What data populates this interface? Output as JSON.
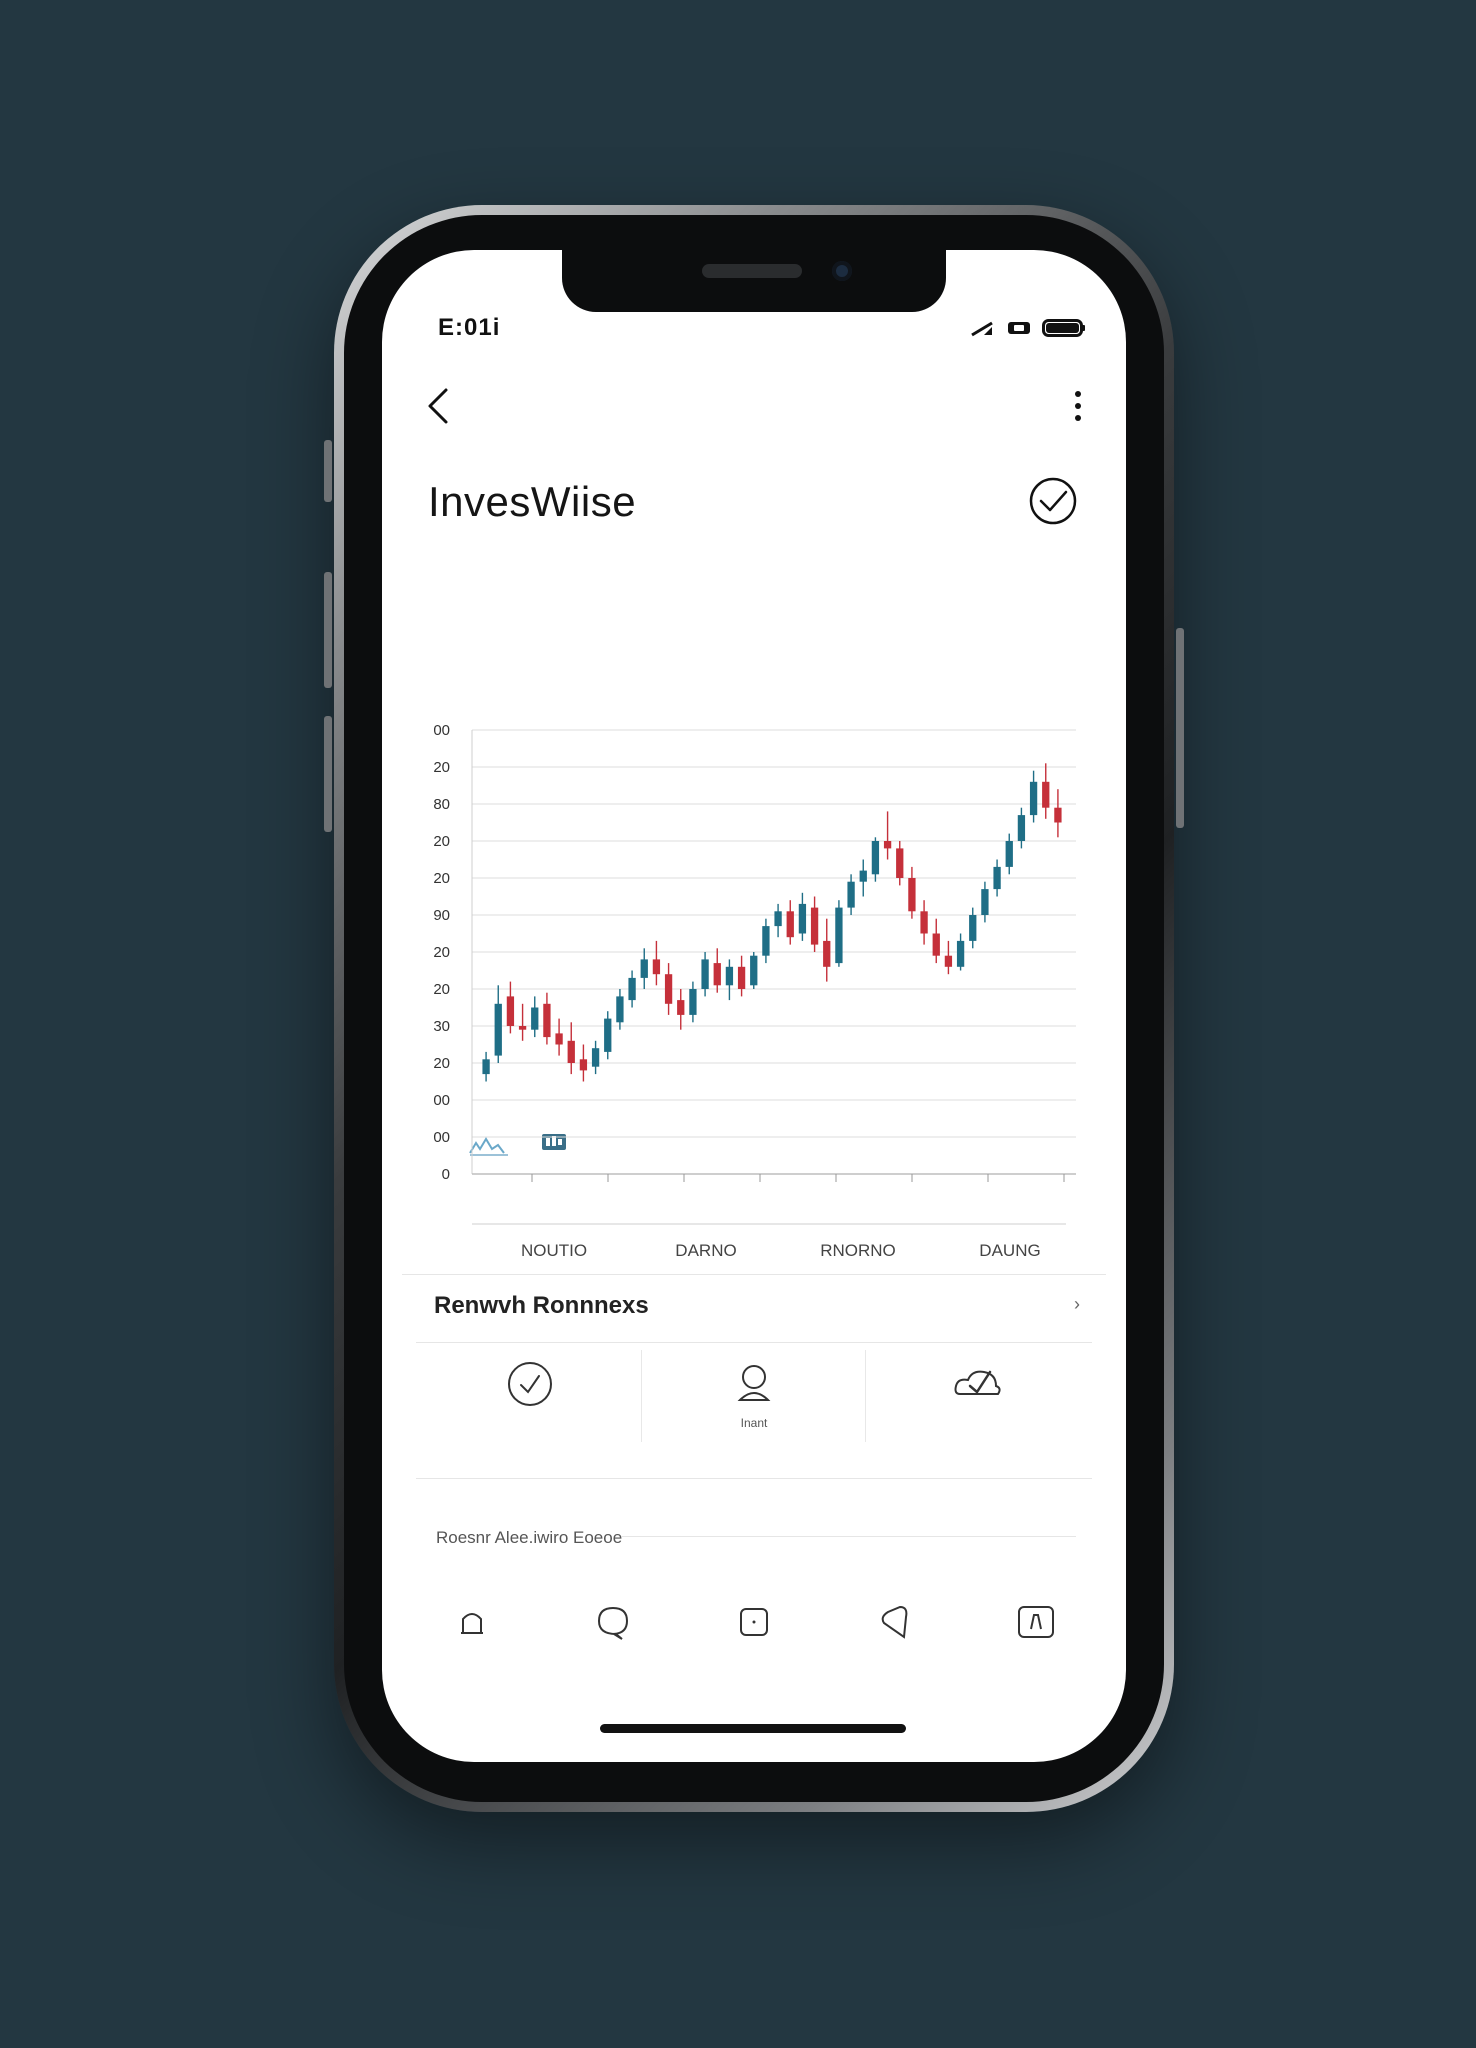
{
  "status_bar": {
    "time": "E:01i"
  },
  "header": {
    "app_title": "InvesWiise"
  },
  "chart_data": {
    "type": "candlestick",
    "y_tick_labels": [
      "0",
      "00",
      "00",
      "20",
      "30",
      "20",
      "20",
      "90",
      "20",
      "20",
      "80",
      "20",
      "00"
    ],
    "x_tick_labels": [
      "NOUTIO",
      "DARNO",
      "RNORNO",
      "DAUNG"
    ],
    "grid": true,
    "colors": {
      "up": "#1f6e86",
      "down": "#c5303a"
    },
    "candles": [
      {
        "o": 2.7,
        "h": 3.3,
        "l": 2.5,
        "c": 3.1
      },
      {
        "o": 3.2,
        "h": 5.1,
        "l": 3.0,
        "c": 4.6
      },
      {
        "o": 4.8,
        "h": 5.2,
        "l": 3.8,
        "c": 4.0
      },
      {
        "o": 4.0,
        "h": 4.6,
        "l": 3.6,
        "c": 3.9
      },
      {
        "o": 3.9,
        "h": 4.8,
        "l": 3.7,
        "c": 4.5
      },
      {
        "o": 4.6,
        "h": 4.9,
        "l": 3.5,
        "c": 3.7
      },
      {
        "o": 3.8,
        "h": 4.2,
        "l": 3.2,
        "c": 3.5
      },
      {
        "o": 3.6,
        "h": 4.1,
        "l": 2.7,
        "c": 3.0
      },
      {
        "o": 3.1,
        "h": 3.5,
        "l": 2.5,
        "c": 2.8
      },
      {
        "o": 2.9,
        "h": 3.6,
        "l": 2.7,
        "c": 3.4
      },
      {
        "o": 3.3,
        "h": 4.4,
        "l": 3.1,
        "c": 4.2
      },
      {
        "o": 4.1,
        "h": 5.0,
        "l": 3.9,
        "c": 4.8
      },
      {
        "o": 4.7,
        "h": 5.5,
        "l": 4.5,
        "c": 5.3
      },
      {
        "o": 5.3,
        "h": 6.1,
        "l": 5.0,
        "c": 5.8
      },
      {
        "o": 5.8,
        "h": 6.3,
        "l": 5.1,
        "c": 5.4
      },
      {
        "o": 5.4,
        "h": 5.7,
        "l": 4.3,
        "c": 4.6
      },
      {
        "o": 4.7,
        "h": 5.0,
        "l": 3.9,
        "c": 4.3
      },
      {
        "o": 4.3,
        "h": 5.2,
        "l": 4.1,
        "c": 5.0
      },
      {
        "o": 5.0,
        "h": 6.0,
        "l": 4.8,
        "c": 5.8
      },
      {
        "o": 5.7,
        "h": 6.1,
        "l": 4.9,
        "c": 5.1
      },
      {
        "o": 5.1,
        "h": 5.8,
        "l": 4.7,
        "c": 5.6
      },
      {
        "o": 5.6,
        "h": 5.9,
        "l": 4.8,
        "c": 5.0
      },
      {
        "o": 5.1,
        "h": 6.0,
        "l": 5.0,
        "c": 5.9
      },
      {
        "o": 5.9,
        "h": 6.9,
        "l": 5.7,
        "c": 6.7
      },
      {
        "o": 6.7,
        "h": 7.3,
        "l": 6.4,
        "c": 7.1
      },
      {
        "o": 7.1,
        "h": 7.4,
        "l": 6.2,
        "c": 6.4
      },
      {
        "o": 6.5,
        "h": 7.6,
        "l": 6.3,
        "c": 7.3
      },
      {
        "o": 7.2,
        "h": 7.5,
        "l": 6.0,
        "c": 6.2
      },
      {
        "o": 6.3,
        "h": 6.9,
        "l": 5.2,
        "c": 5.6
      },
      {
        "o": 5.7,
        "h": 7.4,
        "l": 5.6,
        "c": 7.2
      },
      {
        "o": 7.2,
        "h": 8.1,
        "l": 7.0,
        "c": 7.9
      },
      {
        "o": 7.9,
        "h": 8.5,
        "l": 7.5,
        "c": 8.2
      },
      {
        "o": 8.1,
        "h": 9.1,
        "l": 7.9,
        "c": 9.0
      },
      {
        "o": 9.0,
        "h": 9.8,
        "l": 8.5,
        "c": 8.8
      },
      {
        "o": 8.8,
        "h": 9.0,
        "l": 7.8,
        "c": 8.0
      },
      {
        "o": 8.0,
        "h": 8.3,
        "l": 6.9,
        "c": 7.1
      },
      {
        "o": 7.1,
        "h": 7.4,
        "l": 6.2,
        "c": 6.5
      },
      {
        "o": 6.5,
        "h": 6.9,
        "l": 5.7,
        "c": 5.9
      },
      {
        "o": 5.9,
        "h": 6.3,
        "l": 5.4,
        "c": 5.6
      },
      {
        "o": 5.6,
        "h": 6.5,
        "l": 5.5,
        "c": 6.3
      },
      {
        "o": 6.3,
        "h": 7.2,
        "l": 6.1,
        "c": 7.0
      },
      {
        "o": 7.0,
        "h": 7.9,
        "l": 6.8,
        "c": 7.7
      },
      {
        "o": 7.7,
        "h": 8.5,
        "l": 7.5,
        "c": 8.3
      },
      {
        "o": 8.3,
        "h": 9.2,
        "l": 8.1,
        "c": 9.0
      },
      {
        "o": 9.0,
        "h": 9.9,
        "l": 8.8,
        "c": 9.7
      },
      {
        "o": 9.7,
        "h": 10.9,
        "l": 9.5,
        "c": 10.6
      },
      {
        "o": 10.6,
        "h": 11.1,
        "l": 9.6,
        "c": 9.9
      },
      {
        "o": 9.9,
        "h": 10.4,
        "l": 9.1,
        "c": 9.5
      }
    ]
  },
  "section": {
    "title": "Renwvh Ronnnexs",
    "chevron": "›"
  },
  "quick_actions": [
    {
      "icon": "check-circle-icon",
      "label": ""
    },
    {
      "icon": "user-icon",
      "label": "Inant"
    },
    {
      "icon": "check-cloud-icon",
      "label": ""
    }
  ],
  "subsection": {
    "title": "Roesnr  Alee.iwiro   Eoeoe"
  },
  "bottom_tabs": [
    {
      "icon": "home-icon"
    },
    {
      "icon": "chat-icon"
    },
    {
      "icon": "square-icon"
    },
    {
      "icon": "location-icon"
    },
    {
      "icon": "portfolio-icon"
    }
  ]
}
